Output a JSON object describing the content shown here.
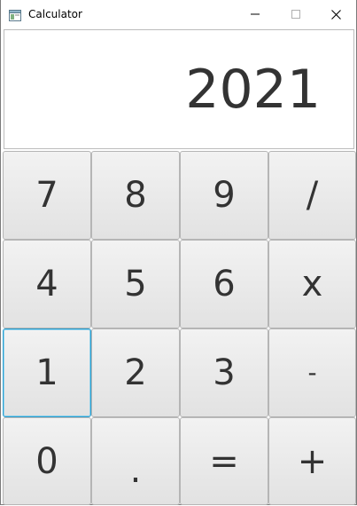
{
  "window": {
    "title": "Calculator",
    "controls": {
      "minimize": "minimize-icon",
      "maximize": "maximize-icon",
      "close": "close-icon"
    }
  },
  "display": {
    "value": "2021"
  },
  "keypad": {
    "rows": [
      [
        "7",
        "8",
        "9",
        "/"
      ],
      [
        "4",
        "5",
        "6",
        "x"
      ],
      [
        "1",
        "2",
        "3",
        "-"
      ],
      [
        "0",
        ".",
        "=",
        "+"
      ]
    ],
    "focused_key": "1"
  },
  "colors": {
    "focus_border": "#2a9fd0",
    "key_text": "#333333",
    "display_text": "#333333"
  }
}
